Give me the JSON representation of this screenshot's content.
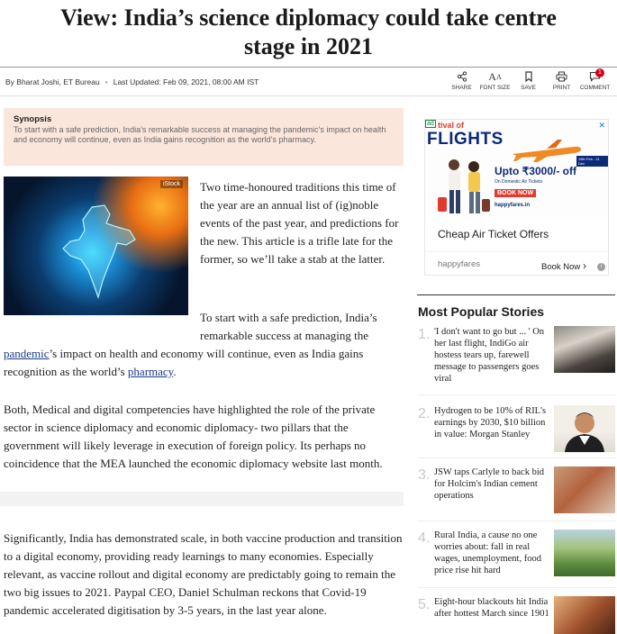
{
  "article": {
    "headline": "View: India’s science diplomacy could take centre stage in 2021",
    "byline_author": "By Bharat Joshi, ET Bureau",
    "byline_updated": "Last Updated: Feb 09, 2021, 08:00 AM IST"
  },
  "actions": [
    {
      "label": "SHARE",
      "icon": "share-icon"
    },
    {
      "label": "FONT SIZE",
      "icon": "font-size-icon"
    },
    {
      "label": "SAVE",
      "icon": "bookmark-icon"
    },
    {
      "label": "PRINT",
      "icon": "print-icon"
    },
    {
      "label": "COMMENT",
      "icon": "comment-icon",
      "badge": "1"
    }
  ],
  "synopsis": {
    "title": "Synopsis",
    "text": "To start with a safe prediction, India’s remarkable success at managing the pandemic’s impact on health and economy will continue, even as India gains recognition as the world’s pharmacy."
  },
  "hero_image": {
    "credit": "iStock"
  },
  "body": {
    "p1": "Two time-honoured traditions this time of the year are an annual list of (ig)noble events of the past year, and predictions for the new. This article is a trifle late for the former, so we’ll take a stab at the latter.",
    "p2_start": "To start with a safe prediction, India’s remarkable success at managing the",
    "p2_link1": "pandemic",
    "p2_mid": "’s impact on health and economy will continue, even as India gains recognition as the world’s ",
    "p2_link2": "pharmacy",
    "p2_end": ".",
    "p3": "Both, Medical and digital competencies have highlighted the role of the private sector in science diplomacy and economic diplomacy- two pillars that the government will likely leverage in execution of foreign policy. Its perhaps no coincidence that the MEA launched the economic diplomacy website last month.",
    "p4": "Significantly, India has demonstrated scale, in both vaccine production and transition to a digital economy, providing ready learnings to many economies. Especially relevant, as vaccine rollout and digital economy are predictably going to remain the two big issues to 2021. Paypal CEO, Daniel Schulman reckons that Covid-19 pandemic accelerated digitisation by 3-5 years, in the last year alone."
  },
  "ad": {
    "tag": "ad",
    "close": "✕",
    "festival": "tival of",
    "flights": "FLIGHTS",
    "dates": "18th Feb - 21 Dec",
    "offer": "Upto ₹3000/- off",
    "domestic": "On Domestic Air Tickets",
    "book": "BOOK NOW",
    "site": "happyfares.in",
    "headline": "Cheap Air Ticket Offers",
    "advertiser": "happyfares",
    "cta": "Book Now",
    "cta_arrow": "›",
    "info": "i"
  },
  "popular": {
    "title": "Most Popular Stories",
    "items": [
      {
        "num": "1.",
        "text": "'I don't want to go but ... ' On her last flight, IndiGo air hostess tears up, farewell message to passengers goes viral"
      },
      {
        "num": "2.",
        "text": "Hydrogen to be 10% of RIL's earnings by 2030, $10 billion in value: Morgan Stanley"
      },
      {
        "num": "3.",
        "text": "JSW taps Carlyle to back bid for Holcim's Indian cement operations"
      },
      {
        "num": "4.",
        "text": "Rural India, a cause no one worries about: fall in real wages, unemployment, food price rise hit hard"
      },
      {
        "num": "5.",
        "text": "Eight-hour blackouts hit India after hottest March since 1901"
      }
    ]
  },
  "colors": {
    "synopsis_bg": "#fbe6dc",
    "link": "#1a3a8c",
    "badge": "#d0021b",
    "ad_brand": "#0c2a7a",
    "ad_accent": "#e23b2e"
  }
}
